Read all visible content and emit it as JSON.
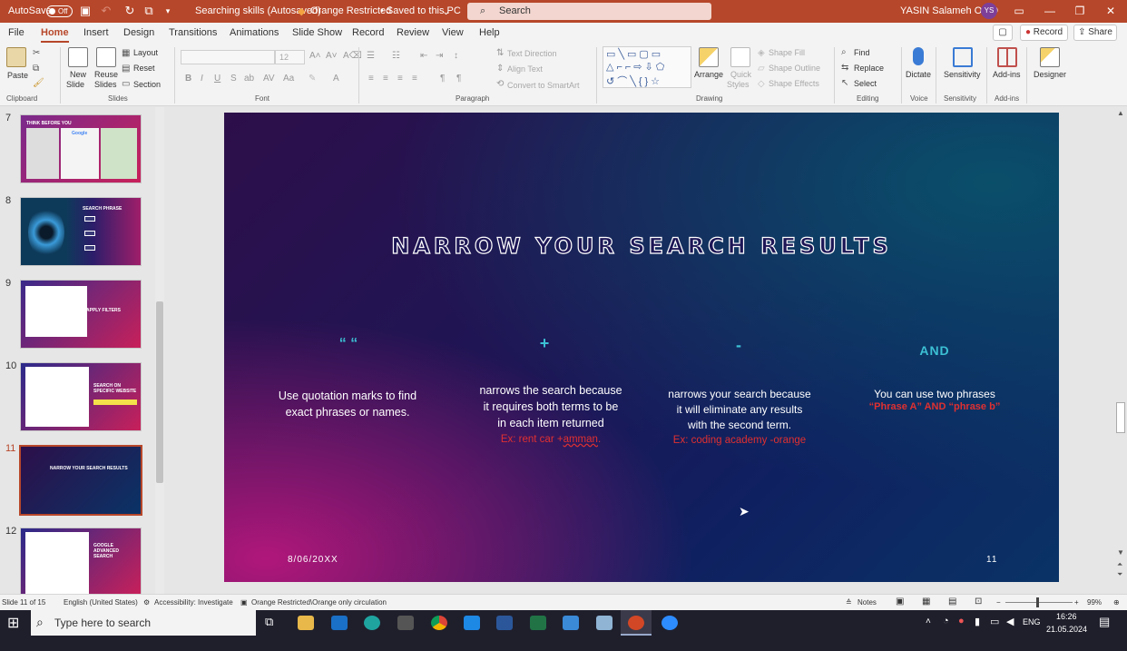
{
  "titlebar": {
    "autosave_label": "AutoSave",
    "autosave_state": "Off",
    "doc_title": "Searching skills (Autosaved)",
    "sensitivity": "Orange Restricted",
    "saved_status": "• Saved to this PC",
    "search_placeholder": "Search",
    "user_name": "YASIN Salameh O-JO",
    "user_initials": "YS"
  },
  "tabs": [
    "File",
    "Home",
    "Insert",
    "Design",
    "Transitions",
    "Animations",
    "Slide Show",
    "Record",
    "Review",
    "View",
    "Help"
  ],
  "active_tab": "Home",
  "topright": {
    "record_label": "Record",
    "share_label": "Share"
  },
  "ribbon": {
    "clipboard": {
      "paste": "Paste",
      "group": "Clipboard"
    },
    "slides": {
      "new_slide_1": "New",
      "new_slide_2": "Slide",
      "reuse_1": "Reuse",
      "reuse_2": "Slides",
      "layout": "Layout",
      "reset": "Reset",
      "section": "Section",
      "group": "Slides"
    },
    "font": {
      "size": "12",
      "group": "Font"
    },
    "paragraph": {
      "text_direction": "Text Direction",
      "align_text": "Align Text",
      "convert_smartart": "Convert to SmartArt",
      "group": "Paragraph"
    },
    "drawing": {
      "arrange": "Arrange",
      "quick_styles_1": "Quick",
      "quick_styles_2": "Styles",
      "shape_fill": "Shape Fill",
      "shape_outline": "Shape Outline",
      "shape_effects": "Shape Effects",
      "group": "Drawing"
    },
    "editing": {
      "find": "Find",
      "replace": "Replace",
      "select": "Select",
      "group": "Editing"
    },
    "voice": {
      "dictate": "Dictate",
      "group": "Voice"
    },
    "sensitivity": {
      "label": "Sensitivity",
      "group": "Sensitivity"
    },
    "addins": {
      "label": "Add-ins",
      "group": "Add-ins"
    },
    "designer": {
      "label": "Designer"
    }
  },
  "thumbnails": [
    {
      "num": "7",
      "title": "THINK BEFORE YOU",
      "text2": "Google"
    },
    {
      "num": "8",
      "title": "SEARCH PHRASE"
    },
    {
      "num": "9",
      "title": "APPLY FILTERS"
    },
    {
      "num": "10",
      "title": "SEARCH ON SPECIFIC WEBSITE"
    },
    {
      "num": "11",
      "title": "NARROW YOUR SEARCH RESULTS"
    },
    {
      "num": "12",
      "title": "GOOGLE ADVANCED SEARCH"
    }
  ],
  "slide": {
    "title": "NARROW YOUR SEARCH RESULTS",
    "columns": [
      {
        "symbol": "“ “",
        "lines": [
          "Use quotation marks to find",
          "exact phrases or names."
        ],
        "example": ""
      },
      {
        "symbol": "+",
        "lines": [
          "narrows the search because",
          "it requires both terms to be",
          "in each item returned"
        ],
        "example_prefix": "Ex: rent car +",
        "example_underlined": "amman",
        "example_suffix": "."
      },
      {
        "symbol": "-",
        "lines": [
          "narrows your search because",
          "it will eliminate any results",
          "with the second term."
        ],
        "example": "Ex: coding academy -orange"
      },
      {
        "symbol": "AND",
        "lines": [
          "You can use two phrases"
        ],
        "example": "“Phrase A” AND “phrase b”"
      }
    ],
    "date": "8/06/20XX",
    "page_number": "11"
  },
  "status": {
    "slide_of": "Slide 11 of 15",
    "language": "English (United States)",
    "accessibility": "Accessibility: Investigate",
    "sensitivity": "Orange Restricted\\Orange only circulation",
    "notes": "Notes",
    "zoom": "99%"
  },
  "taskbar": {
    "search_placeholder": "Type here to search",
    "lang": "ENG",
    "time": "16:26",
    "date": "21.05.2024"
  },
  "colors": {
    "accent": "#b7472a",
    "cyan": "#3cc0d4",
    "example_red": "#e03030"
  }
}
